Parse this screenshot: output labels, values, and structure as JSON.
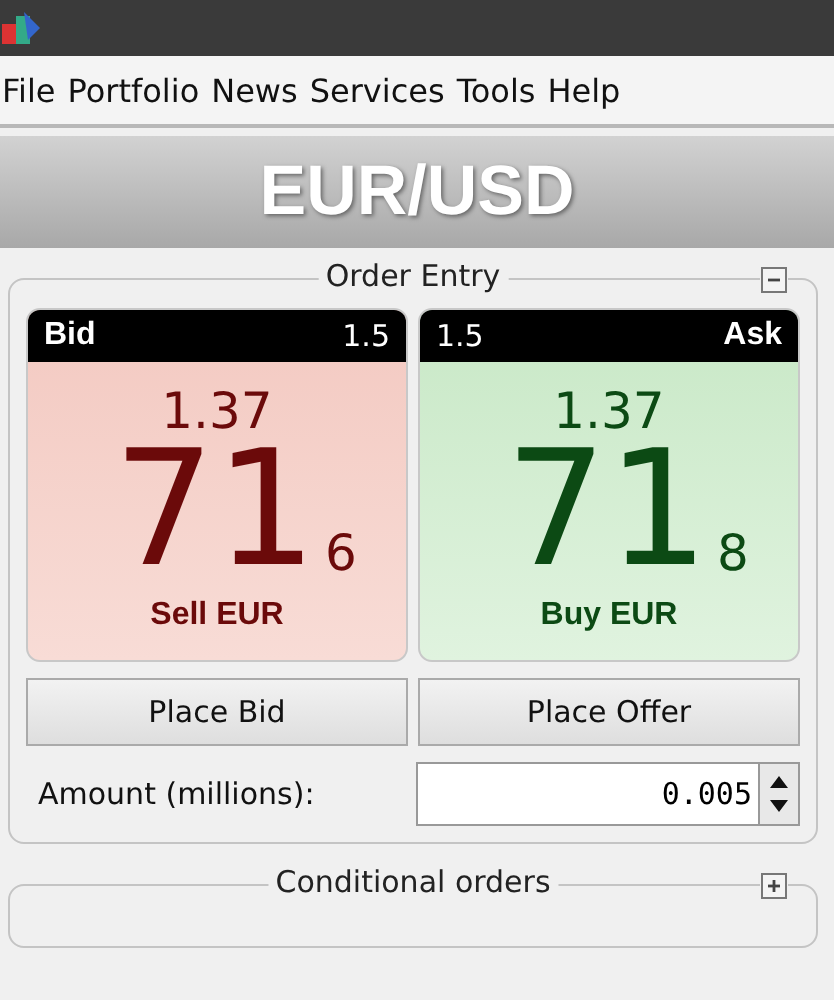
{
  "menu": [
    "File",
    "Portfolio",
    "News",
    "Services",
    "Tools",
    "Help"
  ],
  "instrument": "EUR/USD",
  "order_entry": {
    "title": "Order Entry",
    "expanded": true,
    "quotes": [
      {
        "kind": "bid",
        "label": "Bid",
        "size": "1.5",
        "big_figure": "1.37",
        "pips": "71",
        "fraction": "6",
        "action": "Sell EUR"
      },
      {
        "kind": "ask",
        "label": "Ask",
        "size": "1.5",
        "big_figure": "1.37",
        "pips": "71",
        "fraction": "8",
        "action": "Buy EUR"
      }
    ],
    "buttons": [
      "Place Bid",
      "Place Offer"
    ],
    "amount": {
      "label": "Amount (millions):",
      "value": "0.005"
    }
  },
  "conditional_orders": {
    "title": "Conditional orders",
    "expanded": false
  }
}
